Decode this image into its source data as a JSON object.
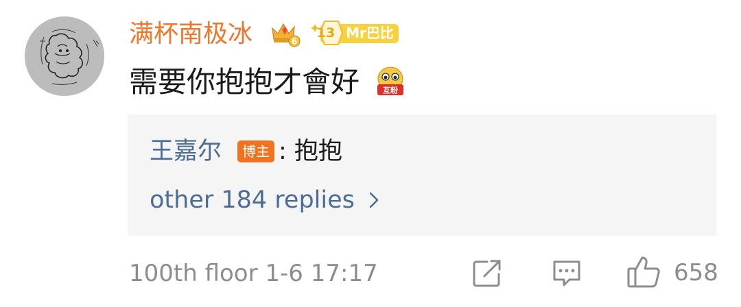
{
  "comment": {
    "username": "满杯南极冰",
    "crown_level": "6",
    "fan_badge": {
      "level": "13",
      "name": "Mr巴比"
    },
    "text": "需要你抱抱才會好",
    "emoji_label": "互粉"
  },
  "reply": {
    "author": "王嘉尔",
    "author_badge": "博主",
    "content": ": 抱抱",
    "more_label": "other 184 replies"
  },
  "footer": {
    "floor": "100th floor",
    "date": "1-6 17:17",
    "like_count": "658"
  },
  "colors": {
    "username": "#f0762a",
    "link_blue": "#4b6d93",
    "meta_gray": "#8c8c8c",
    "reply_bg": "#f5f5f5",
    "blogger_badge": "#f2731f",
    "fan_badge_yellow": "#f7d23e"
  },
  "icons": {
    "crown": "crown-icon",
    "more": "chevron-right-icon",
    "share": "share-icon",
    "comment": "comment-icon",
    "like": "thumbs-up-icon"
  }
}
